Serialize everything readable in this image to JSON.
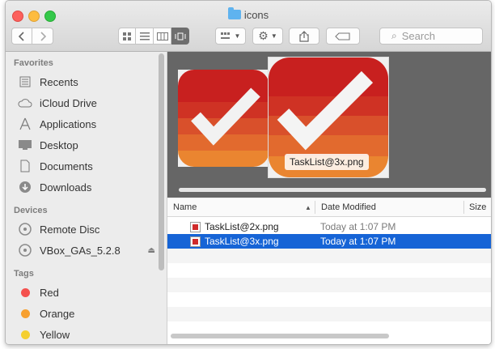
{
  "window": {
    "title": "icons",
    "colors": {
      "selection": "#1664d6",
      "accent_red": "#d02a2a"
    }
  },
  "toolbar": {
    "back_icon": "chevron-left-icon",
    "forward_icon": "chevron-right-icon",
    "view_modes": [
      "icon-view",
      "list-view",
      "column-view",
      "cover-flow-view"
    ],
    "active_view": "cover-flow-view",
    "search_placeholder": "Search"
  },
  "sidebar": {
    "sections": [
      {
        "heading": "Favorites",
        "items": [
          {
            "label": "Recents",
            "icon": "recents-icon"
          },
          {
            "label": "iCloud Drive",
            "icon": "cloud-icon"
          },
          {
            "label": "Applications",
            "icon": "applications-icon"
          },
          {
            "label": "Desktop",
            "icon": "desktop-icon"
          },
          {
            "label": "Documents",
            "icon": "documents-icon"
          },
          {
            "label": "Downloads",
            "icon": "downloads-icon"
          }
        ]
      },
      {
        "heading": "Devices",
        "items": [
          {
            "label": "Remote Disc",
            "icon": "disc-icon"
          },
          {
            "label": "VBox_GAs_5.2.8",
            "icon": "disc-icon"
          }
        ]
      },
      {
        "heading": "Tags",
        "items": [
          {
            "label": "Red",
            "color": "#f4514e"
          },
          {
            "label": "Orange",
            "color": "#f7a030"
          },
          {
            "label": "Yellow",
            "color": "#f5cf2f"
          }
        ]
      }
    ]
  },
  "preview": {
    "selected_label": "TaskList@3x.png"
  },
  "list": {
    "columns": [
      "Name",
      "Date Modified",
      "Size"
    ],
    "rows": [
      {
        "name": "TaskList@2x.png",
        "date": "Today at 1:07 PM",
        "selected": false
      },
      {
        "name": "TaskList@3x.png",
        "date": "Today at 1:07 PM",
        "selected": true
      }
    ]
  }
}
